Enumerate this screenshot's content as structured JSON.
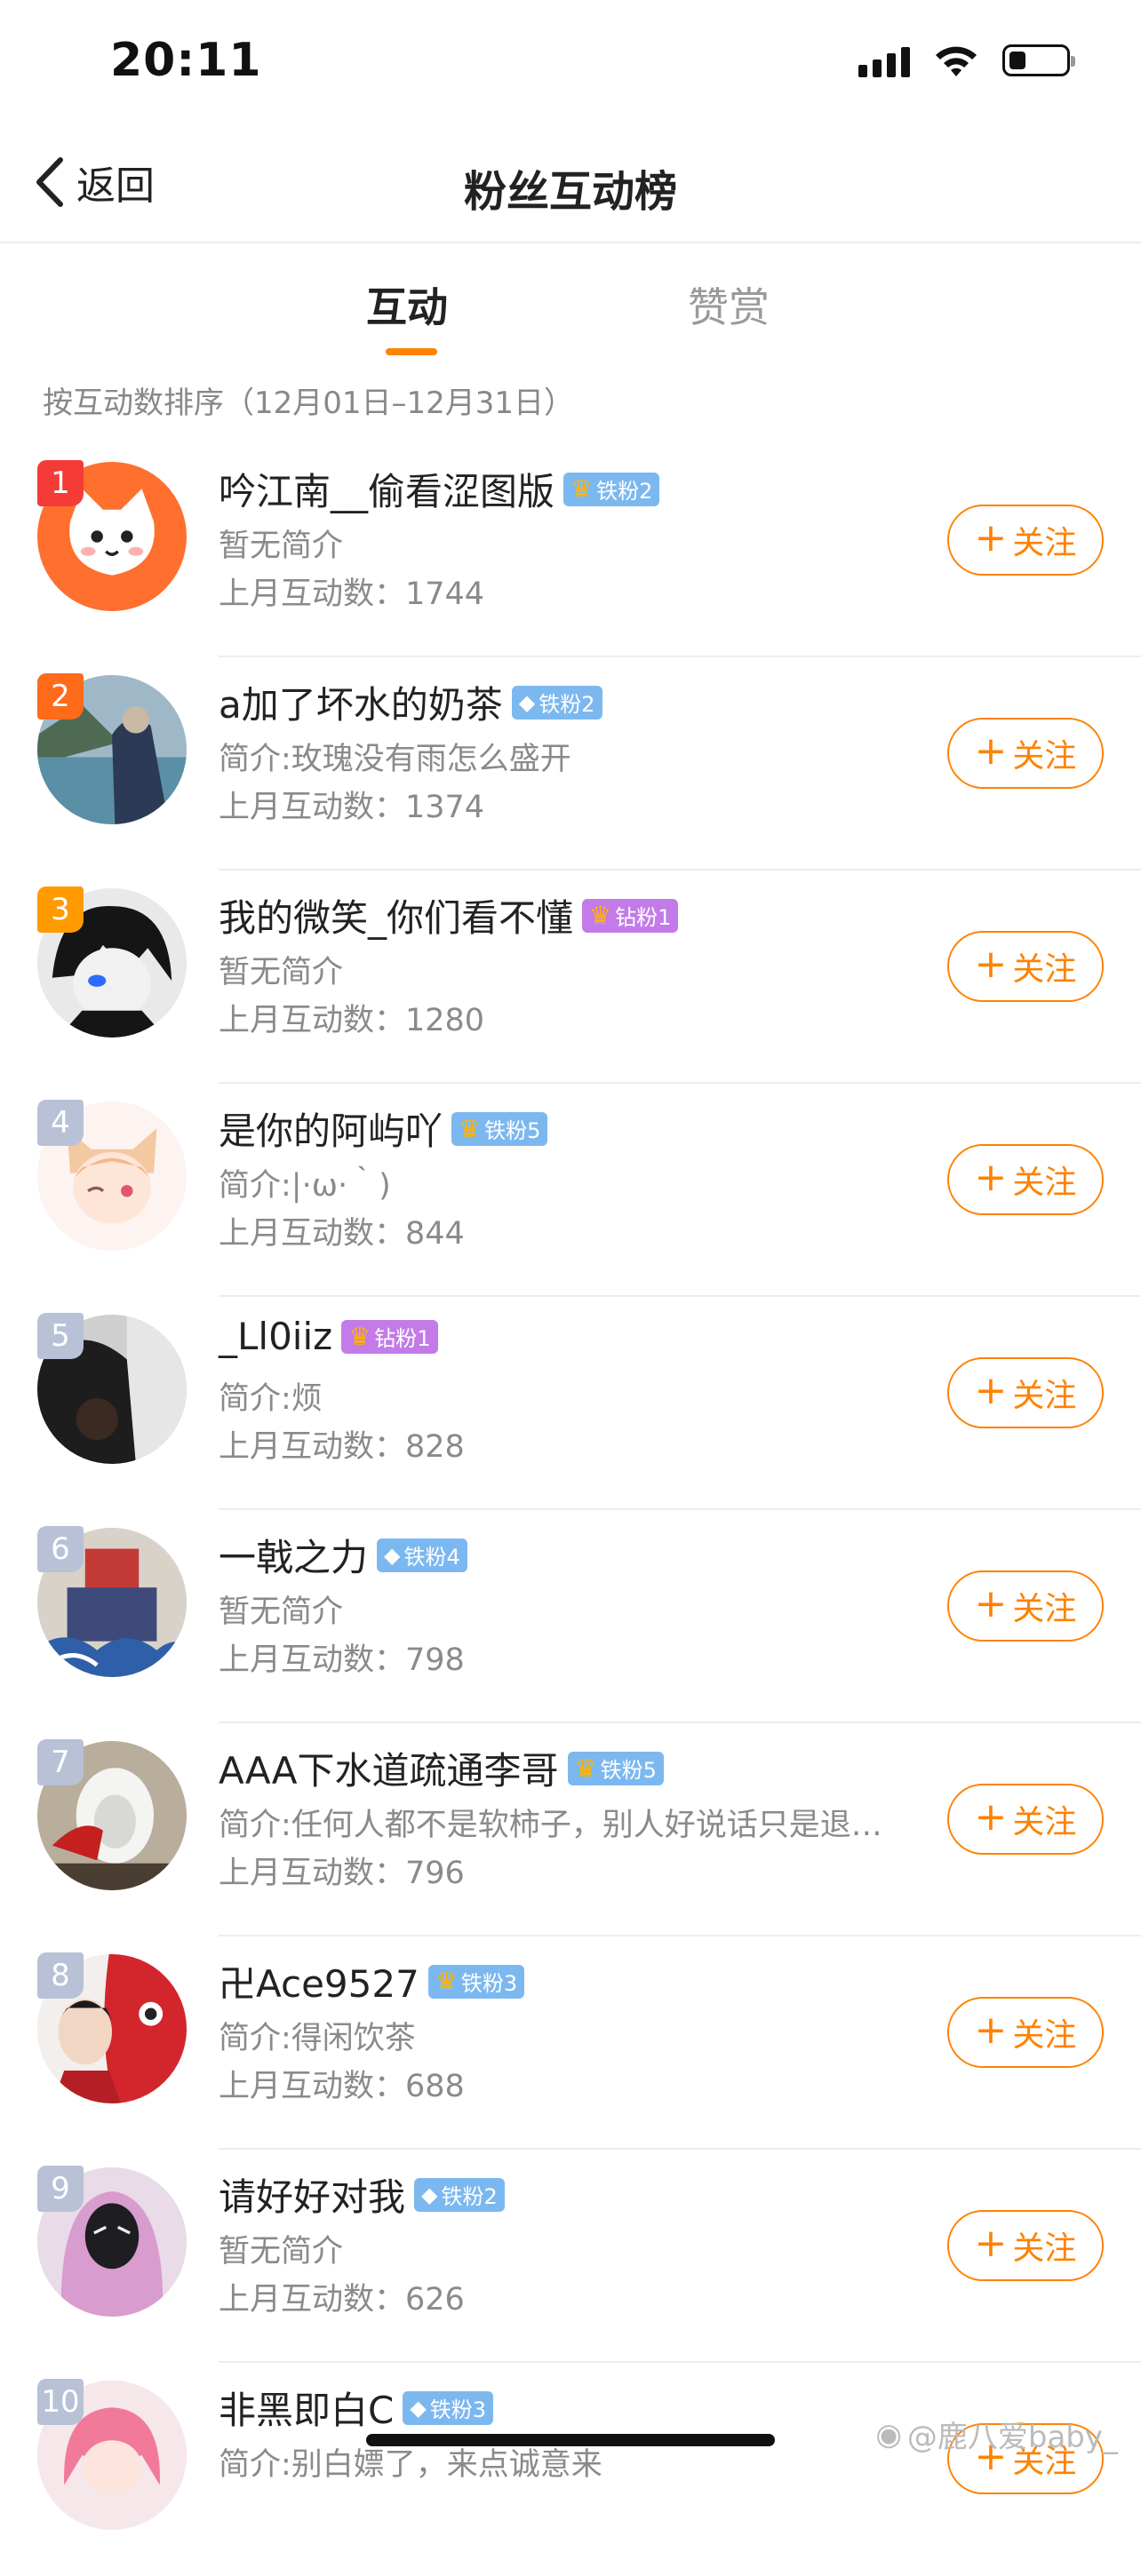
{
  "status_bar": {
    "time": "20:11"
  },
  "nav": {
    "back_label": "返回",
    "title": "粉丝互动榜"
  },
  "tabs": [
    {
      "label": "互动",
      "active": true
    },
    {
      "label": "赞赏",
      "active": false
    }
  ],
  "sort_note": "按互动数排序（12月01日–12月31日）",
  "follow_label": "关注",
  "colors": {
    "accent": "#ff8200",
    "rank1": "#f43b38",
    "rank2": "#ff6a1b",
    "rank3": "#ff9a00",
    "rank_other": "#b8c1d6"
  },
  "rows": [
    {
      "rank": "1",
      "name": "吟江南__偷看涩图版",
      "badge": "铁粉2",
      "badge_type": "crown-iron",
      "intro": "暂无简介",
      "count": "上月互动数：1744",
      "avatar": "cat-avatar-icon"
    },
    {
      "rank": "2",
      "name": "a加了坏水的奶茶",
      "badge": "铁粉2",
      "badge_type": "gem-iron",
      "intro": "简介:玫瑰没有雨怎么盛开",
      "count": "上月互动数：1374",
      "avatar": "lake-photo-avatar"
    },
    {
      "rank": "3",
      "name": "我的微笑_你们看不懂",
      "badge": "钻粉1",
      "badge_type": "crown-diamond",
      "intro": "暂无简介",
      "count": "上月互动数：1280",
      "avatar": "anime-boy-avatar"
    },
    {
      "rank": "4",
      "name": "是你的阿屿吖",
      "badge": "铁粉5",
      "badge_type": "crown-iron",
      "intro": "简介:|·ω·｀)",
      "count": "上月互动数：844",
      "avatar": "anime-girl-avatar"
    },
    {
      "rank": "5",
      "name": "_Ll0iiz",
      "badge": "钻粉1",
      "badge_type": "crown-diamond",
      "intro": "简介:烦",
      "count": "上月互动数：828",
      "avatar": "dark-photo-avatar"
    },
    {
      "rank": "6",
      "name": "一戟之力",
      "badge": "铁粉4",
      "badge_type": "gem-iron",
      "intro": "暂无简介",
      "count": "上月互动数：798",
      "avatar": "mecha-avatar"
    },
    {
      "rank": "7",
      "name": "AAA下水道疏通李哥",
      "badge": "铁粉5",
      "badge_type": "crown-iron",
      "intro": "简介:任何人都不是软柿子，别人好说话只是退…",
      "count": "上月互动数：796",
      "avatar": "toilet-photo-avatar"
    },
    {
      "rank": "8",
      "name": "卍Ace9527",
      "badge": "铁粉3",
      "badge_type": "crown-iron",
      "intro": "简介:得闲饮茶",
      "count": "上月互动数：688",
      "avatar": "lion-dance-avatar"
    },
    {
      "rank": "9",
      "name": "请好好对我",
      "badge": "铁粉2",
      "badge_type": "gem-iron",
      "intro": "暂无简介",
      "count": "上月互动数：626",
      "avatar": "pink-hoodie-avatar"
    },
    {
      "rank": "10",
      "name": "非黑即白C",
      "badge": "铁粉3",
      "badge_type": "gem-iron",
      "intro": "简介:别白嫖了，来点诚意来",
      "count": "",
      "avatar": "pink-hair-avatar"
    }
  ],
  "watermark": "@鹿八爱baby_"
}
